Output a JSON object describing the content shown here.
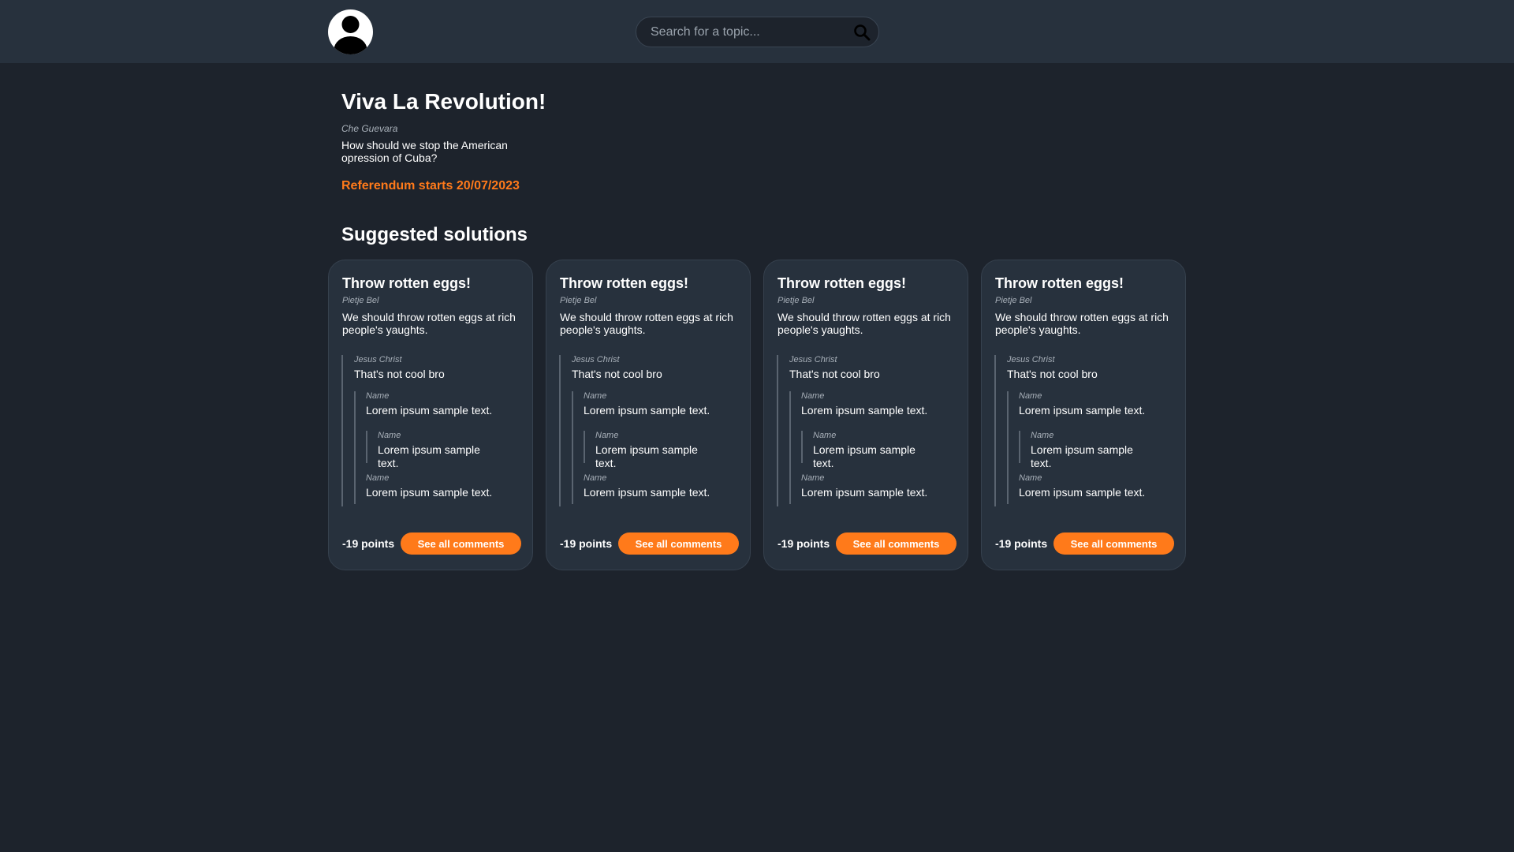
{
  "header": {
    "avatar_icon": "user-avatar-icon",
    "search_placeholder": "Search for a topic...",
    "search_icon": "search-icon"
  },
  "topic": {
    "title": "Viva La Revolution!",
    "author": "Che Guevara",
    "description": "How should we stop the American opression of Cuba?",
    "referendum": "Referendum starts 20/07/2023"
  },
  "solutions_heading": "Suggested solutions",
  "solutions": [
    {
      "title": "Throw rotten eggs!",
      "author": "Pietje Bel",
      "body": "We should throw rotten eggs at rich people's yaughts.",
      "comment": {
        "author": "Jesus Christ",
        "text": "That's not cool bro",
        "replies": [
          {
            "author": "Name",
            "text": "Lorem ipsum sample text.",
            "replies": [
              {
                "author": "Name",
                "text": "Lorem ipsum sample text."
              }
            ]
          },
          {
            "author": "Name",
            "text": "Lorem ipsum sample text."
          }
        ]
      },
      "points": "-19 points",
      "button": "See all comments"
    },
    {
      "title": "Throw rotten eggs!",
      "author": "Pietje Bel",
      "body": "We should throw rotten eggs at rich people's yaughts.",
      "comment": {
        "author": "Jesus Christ",
        "text": "That's not cool bro",
        "replies": [
          {
            "author": "Name",
            "text": "Lorem ipsum sample text.",
            "replies": [
              {
                "author": "Name",
                "text": "Lorem ipsum sample text."
              }
            ]
          },
          {
            "author": "Name",
            "text": "Lorem ipsum sample text."
          }
        ]
      },
      "points": "-19 points",
      "button": "See all comments"
    },
    {
      "title": "Throw rotten eggs!",
      "author": "Pietje Bel",
      "body": "We should throw rotten eggs at rich people's yaughts.",
      "comment": {
        "author": "Jesus Christ",
        "text": "That's not cool bro",
        "replies": [
          {
            "author": "Name",
            "text": "Lorem ipsum sample text.",
            "replies": [
              {
                "author": "Name",
                "text": "Lorem ipsum sample text."
              }
            ]
          },
          {
            "author": "Name",
            "text": "Lorem ipsum sample text."
          }
        ]
      },
      "points": "-19 points",
      "button": "See all comments"
    },
    {
      "title": "Throw rotten eggs!",
      "author": "Pietje Bel",
      "body": "We should throw rotten eggs at rich people's yaughts.",
      "comment": {
        "author": "Jesus Christ",
        "text": "That's not cool bro",
        "replies": [
          {
            "author": "Name",
            "text": "Lorem ipsum sample text.",
            "replies": [
              {
                "author": "Name",
                "text": "Lorem ipsum sample text."
              }
            ]
          },
          {
            "author": "Name",
            "text": "Lorem ipsum sample text."
          }
        ]
      },
      "points": "-19 points",
      "button": "See all comments"
    }
  ],
  "colors": {
    "background": "#1d232c",
    "surface": "#27313d",
    "accent": "#ff7a1a",
    "muted_text": "#a8b0b9"
  }
}
